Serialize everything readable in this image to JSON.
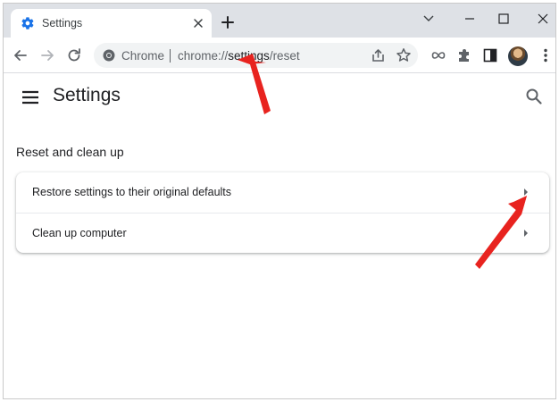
{
  "tab": {
    "title": "Settings"
  },
  "omnibox": {
    "site_label": "Chrome",
    "url_scheme": "chrome://",
    "url_host": "settings",
    "url_path": "/reset"
  },
  "page": {
    "title": "Settings",
    "section_title": "Reset and clean up",
    "rows": [
      {
        "label": "Restore settings to their original defaults"
      },
      {
        "label": "Clean up computer"
      }
    ]
  },
  "colors": {
    "tabstrip_bg": "#dee1e6",
    "accent_blue": "#1a73e8",
    "annotation_red": "#e8231f",
    "text_primary": "#202124",
    "text_secondary": "#5f6368"
  },
  "icons": {
    "favicon": "settings-gear-icon",
    "back": "arrow-left-icon",
    "forward": "arrow-right-icon",
    "reload": "reload-icon",
    "share": "share-icon",
    "bookmark": "star-icon",
    "extensions": "puzzle-icon",
    "side_panel": "side-panel-icon",
    "menu": "kebab-menu-icon",
    "search": "search-icon"
  }
}
